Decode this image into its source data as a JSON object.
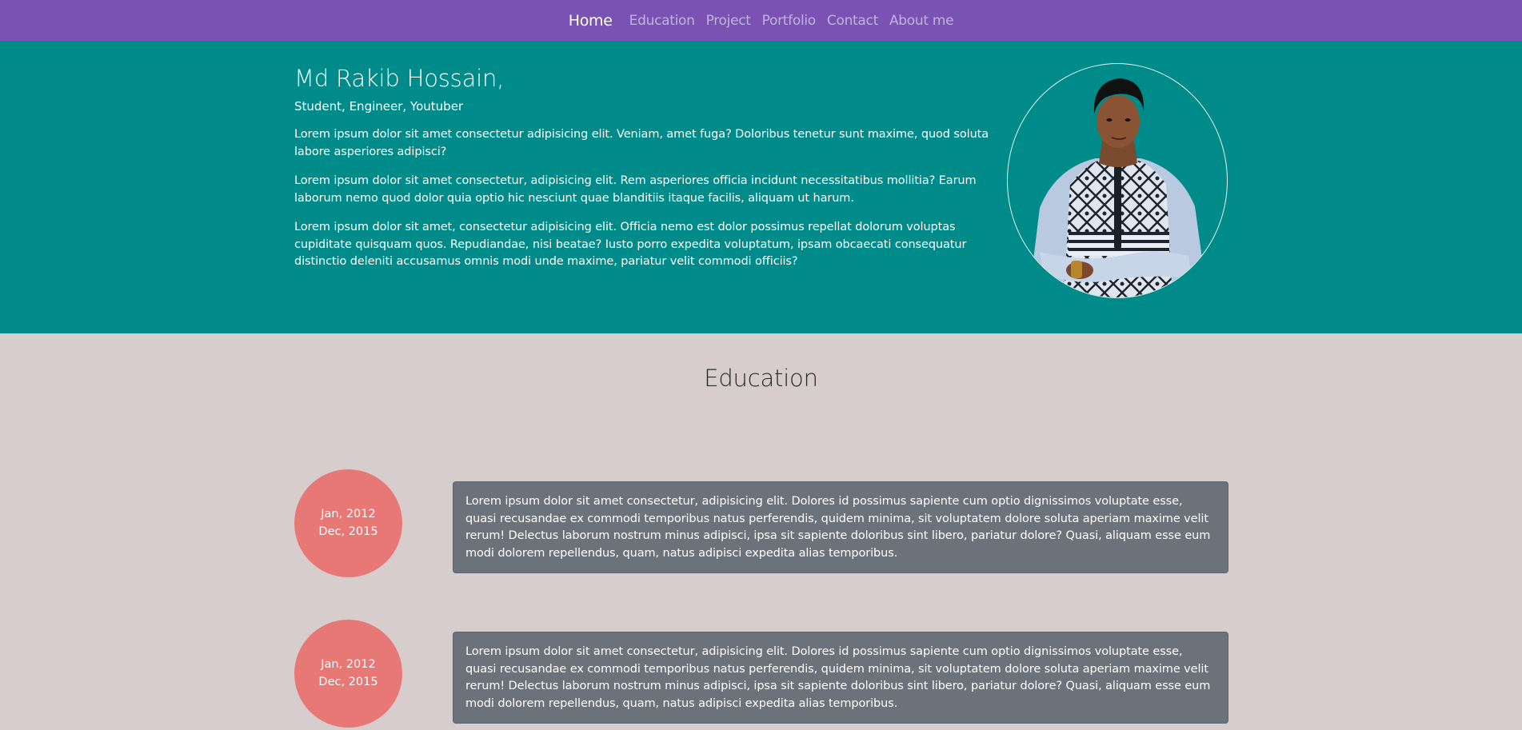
{
  "nav": {
    "items": [
      {
        "label": "Home",
        "active": true
      },
      {
        "label": "Education",
        "active": false
      },
      {
        "label": "Project",
        "active": false
      },
      {
        "label": "Portfolio",
        "active": false
      },
      {
        "label": "Contact",
        "active": false
      },
      {
        "label": "About me",
        "active": false
      }
    ]
  },
  "hero": {
    "name": "Md Rakib Hossain,",
    "roles": "Student, Engineer, Youtuber",
    "paragraphs": [
      "Lorem ipsum dolor sit amet consectetur adipisicing elit. Veniam, amet fuga? Doloribus tenetur sunt maxime, quod soluta labore asperiores adipisci?",
      "Lorem ipsum dolor sit amet consectetur, adipisicing elit. Rem asperiores officia incidunt necessitatibus mollitia? Earum laborum nemo quod dolor quia optio hic nesciunt quae blanditiis itaque facilis, aliquam ut harum.",
      "Lorem ipsum dolor sit amet, consectetur adipisicing elit. Officia nemo est dolor possimus repellat dolorum voluptas cupiditate quisquam quos. Repudiandae, nisi beatae? Iusto porro expedita voluptatum, ipsam obcaecati consequatur distinctio deleniti accusamus omnis modi unde maxime, pariatur velit commodi officiis?"
    ]
  },
  "education": {
    "title": "Education",
    "entries": [
      {
        "start": "Jan, 2012",
        "end": "Dec, 2015",
        "text": "Lorem ipsum dolor sit amet consectetur, adipisicing elit. Dolores id possimus sapiente cum optio dignissimos voluptate esse, quasi recusandae ex commodi temporibus natus perferendis, quidem minima, sit voluptatem dolore soluta aperiam maxime velit rerum! Delectus laborum nostrum minus adipisci, ipsa sit sapiente doloribus sint libero, pariatur dolore? Quasi, aliquam esse eum modi dolorem repellendus, quam, natus adipisci expedita alias temporibus."
      },
      {
        "start": "Jan, 2012",
        "end": "Dec, 2015",
        "text": "Lorem ipsum dolor sit amet consectetur, adipisicing elit. Dolores id possimus sapiente cum optio dignissimos voluptate esse, quasi recusandae ex commodi temporibus natus perferendis, quidem minima, sit voluptatem dolore soluta aperiam maxime velit rerum! Delectus laborum nostrum minus adipisci, ipsa sit sapiente doloribus sint libero, pariatur dolore? Quasi, aliquam esse eum modi dolorem repellendus, quam, natus adipisci expedita alias temporibus."
      }
    ]
  },
  "colors": {
    "navbar": "#7952b3",
    "hero": "#008b8b",
    "page": "#d6cdcc",
    "date_circle": "#e87876",
    "card": "#6b727a"
  }
}
